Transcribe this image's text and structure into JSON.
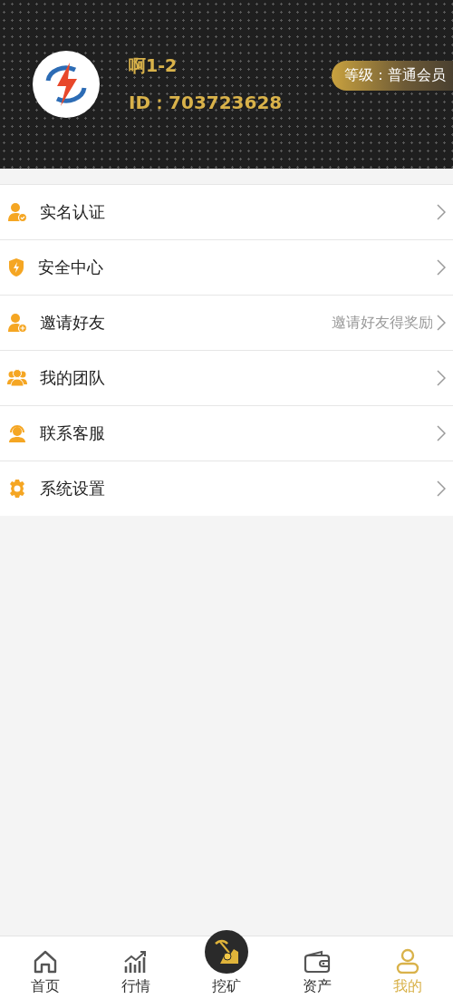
{
  "profile": {
    "name": "啊1-2",
    "id_text": "ID：703723628",
    "level_badge": "等级：普通会员"
  },
  "menu": [
    {
      "label": "实名认证"
    },
    {
      "label": "安全中心"
    },
    {
      "label": "邀请好友",
      "hint": "邀请好友得奖励"
    },
    {
      "label": "我的团队"
    },
    {
      "label": "联系客服"
    },
    {
      "label": "系统设置"
    }
  ],
  "tab_bar": [
    {
      "label": "首页",
      "kind": "home",
      "selected": false
    },
    {
      "label": "行情",
      "kind": "market",
      "selected": false
    },
    {
      "label": "挖矿",
      "kind": "mining",
      "selected": false
    },
    {
      "label": "资产",
      "kind": "wallet",
      "selected": false
    },
    {
      "label": "我的",
      "kind": "profile",
      "selected": true
    }
  ]
}
